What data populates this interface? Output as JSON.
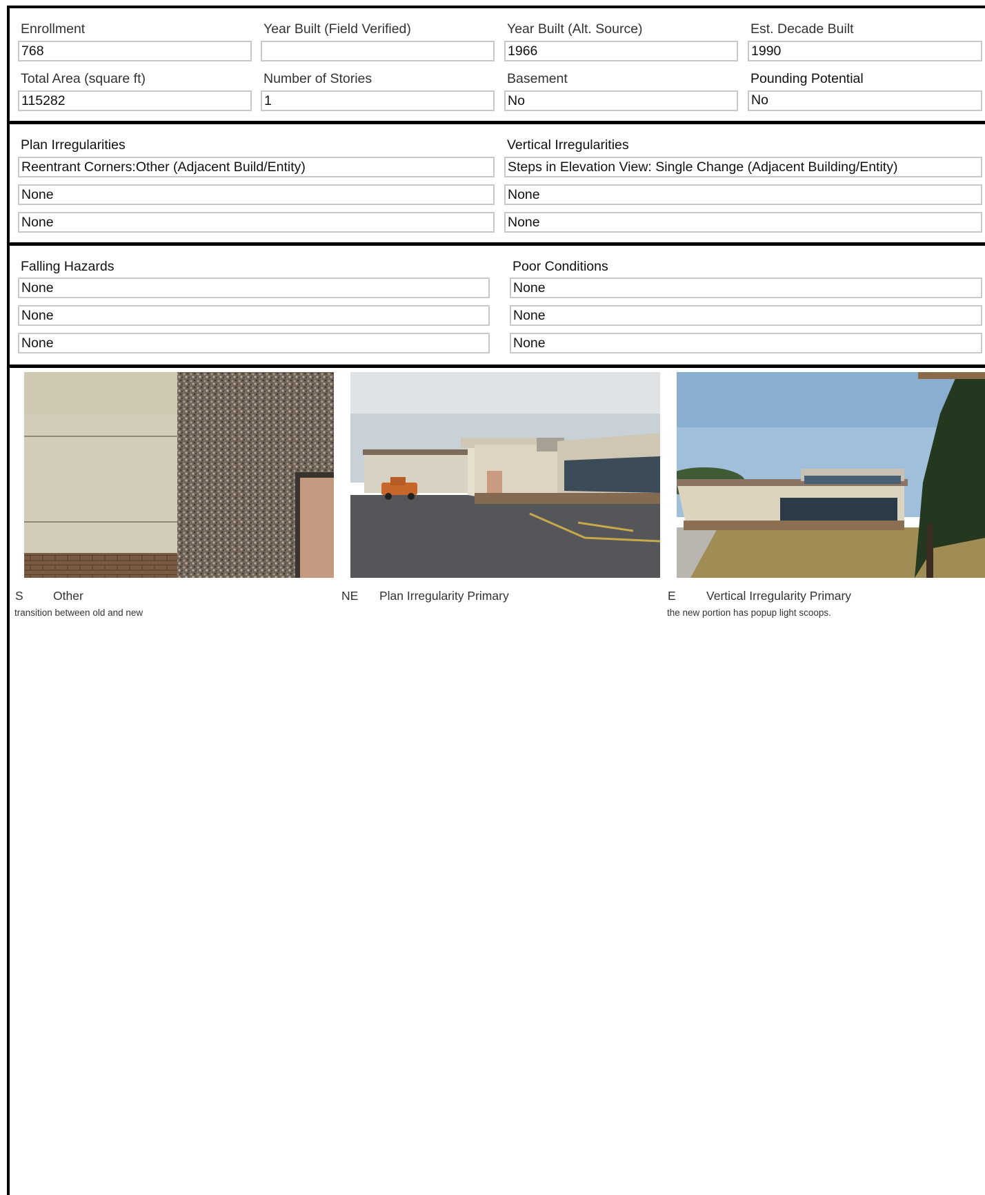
{
  "building": {
    "enrollment": {
      "label": "Enrollment",
      "value": "768"
    },
    "year_built_field": {
      "label": "Year Built (Field Verified)",
      "value": ""
    },
    "year_built_alt": {
      "label": "Year Built (Alt. Source)",
      "value": "1966"
    },
    "decade_built": {
      "label": "Est. Decade Built",
      "value": "1990"
    },
    "total_area": {
      "label": "Total Area (square ft)",
      "value": "115282"
    },
    "stories": {
      "label": "Number of Stories",
      "value": "1"
    },
    "basement": {
      "label": "Basement",
      "value": "No"
    },
    "pounding": {
      "label": "Pounding Potential",
      "value": "No"
    }
  },
  "irregularities": {
    "plan": {
      "label": "Plan Irregularities",
      "values": [
        "Reentrant Corners:Other (Adjacent Build/Entity)",
        "None",
        "None"
      ]
    },
    "vertical": {
      "label": "Vertical Irregularities",
      "values": [
        "Steps in Elevation View: Single Change (Adjacent Building/Entity)",
        "None",
        "None"
      ]
    }
  },
  "hazards": {
    "falling": {
      "label": "Falling Hazards",
      "values": [
        "None",
        "None",
        "None"
      ]
    },
    "poor": {
      "label": "Poor Conditions",
      "values": [
        "None",
        "None",
        "None"
      ]
    }
  },
  "photos": [
    {
      "direction": "S",
      "category": "Other",
      "note": "transition between old and new"
    },
    {
      "direction": "NE",
      "category": "Plan Irregularity Primary",
      "note": ""
    },
    {
      "direction": "E",
      "category": "Vertical Irregularity Primary",
      "note": "the new portion has popup light scoops."
    }
  ]
}
